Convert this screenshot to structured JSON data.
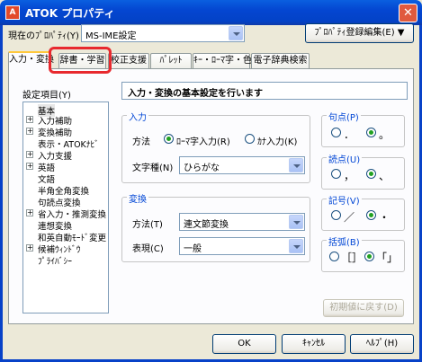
{
  "window": {
    "title": "ATOK プロパティ",
    "app_icon": "A"
  },
  "top": {
    "current_property_label": "現在のﾌﾟﾛﾊﾟﾃｨ(Y)",
    "current_property_value": "MS-IME設定",
    "edit_button": "ﾌﾟﾛﾊﾟﾃｨ登録編集(E) ▼"
  },
  "tabs": [
    "入力・変換",
    "辞書・学習",
    "校正支援",
    "ﾊﾟﾚｯﾄ",
    "ｷｰ・ﾛｰﾏ字・色",
    "電子辞典検索"
  ],
  "settings": {
    "label": "設定項目(Y)",
    "items": [
      "基本",
      "入力補助",
      "変換補助",
      "表示・ATOKﾅﾋﾞ",
      "入力支援",
      "英語",
      "文語",
      "半角全角変換",
      "句読点変換",
      "省入力・推測変換",
      "連想変換",
      "和英自動ﾓｰﾄﾞ変更",
      "候補ｳｨﾝﾄﾞｳ",
      "ﾌﾟﾗｲﾊﾞｼｰ"
    ]
  },
  "description": "入力・変換の基本設定を行います",
  "input_group": {
    "title": "入力",
    "method_label": "方法",
    "romaji_option": "ﾛｰﾏ字入力(R)",
    "kana_option": "ｶﾅ入力(K)",
    "char_type_label": "文字種(N)",
    "char_type_value": "ひらがな"
  },
  "conversion_group": {
    "title": "変換",
    "method_label": "方法(T)",
    "method_value": "連文節変換",
    "expression_label": "表現(C)",
    "expression_value": "一般"
  },
  "kuten": {
    "title": "句点(P)",
    "opt1": "．",
    "opt2": "。"
  },
  "touten": {
    "title": "読点(U)",
    "opt1": "，",
    "opt2": "、"
  },
  "symbol": {
    "title": "記号(V)",
    "opt1": "／",
    "opt2": "・"
  },
  "bracket": {
    "title": "括弧(B)",
    "opt1": "［］",
    "opt2": "「」"
  },
  "reset_button": "初期値に戻す(D)",
  "footer": {
    "ok": "OK",
    "cancel": "ｷｬﾝｾﾙ",
    "help": "ﾍﾙﾌﾟ(H)"
  }
}
